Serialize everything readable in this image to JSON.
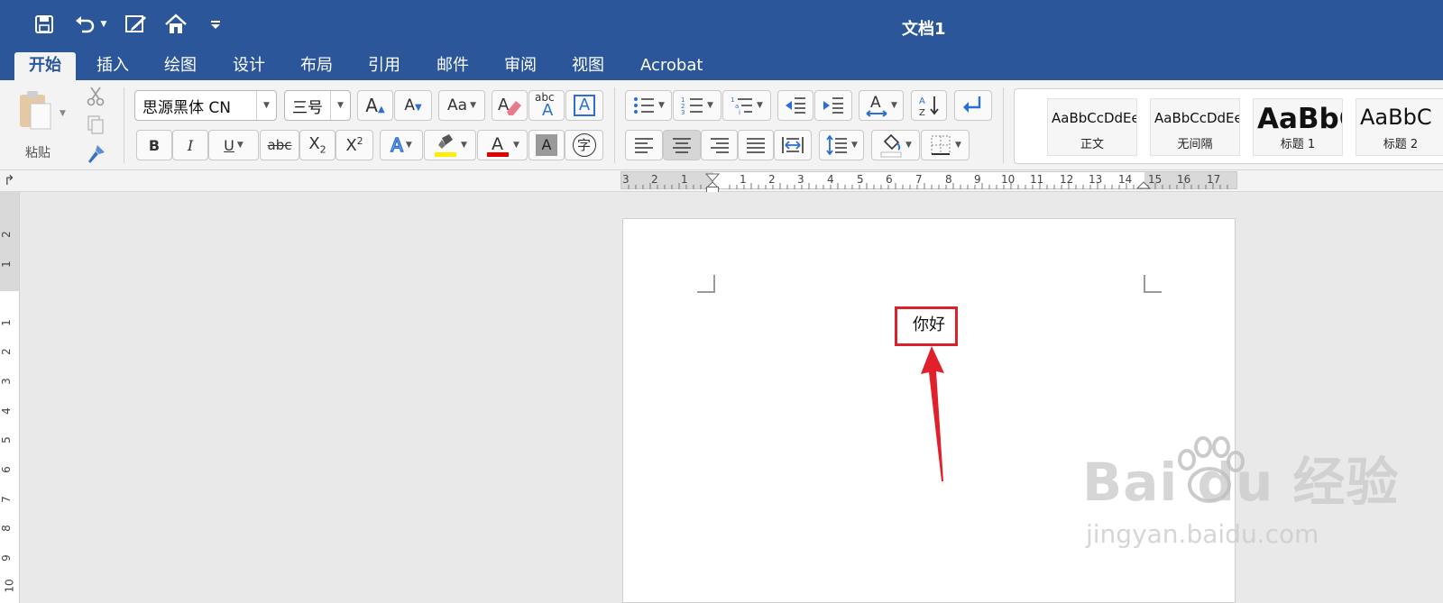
{
  "window": {
    "title": "文档1"
  },
  "quick_access": [
    {
      "name": "save-icon"
    },
    {
      "name": "undo-icon"
    },
    {
      "name": "edit-document-icon"
    },
    {
      "name": "home-icon"
    },
    {
      "name": "customize-qat-icon"
    }
  ],
  "tabs": [
    "开始",
    "插入",
    "绘图",
    "设计",
    "布局",
    "引用",
    "邮件",
    "审阅",
    "视图",
    "Acrobat"
  ],
  "active_tab": "开始",
  "clipboard": {
    "paste_label": "粘贴"
  },
  "font": {
    "family": "思源黑体 CN",
    "size": "三号",
    "abc_label": "abc",
    "strike_label": "abc",
    "char_border_glyph": "字",
    "highlight_color": "#ffee00",
    "font_color": "#e00000"
  },
  "styles": [
    {
      "sample": "AaBbCcDdEe",
      "label": "正文"
    },
    {
      "sample": "AaBbCcDdEe",
      "label": "无间隔"
    },
    {
      "sample": "AaBbC",
      "label": "标题 1"
    },
    {
      "sample": "AaBbC",
      "label": "标题 2"
    }
  ],
  "ruler": {
    "h_numbers": [
      "3",
      "2",
      "1",
      "1",
      "2",
      "3",
      "4",
      "5",
      "6",
      "7",
      "8",
      "9",
      "10",
      "11",
      "12",
      "13",
      "14",
      "15",
      "16",
      "17"
    ],
    "v_numbers": [
      "2",
      "1",
      "1",
      "2",
      "3",
      "4",
      "5",
      "6",
      "7",
      "8",
      "9",
      "10"
    ]
  },
  "document": {
    "text": "你好"
  },
  "annotation": {
    "box_color": "#d9222a",
    "arrow_color": "#e0202a"
  },
  "watermark": {
    "main": "Bai  du 经验",
    "sub": "jingyan.baidu.com"
  },
  "colors": {
    "ribbon_blue": "#2b579a",
    "ribbon_bg": "#f3f3f3"
  }
}
